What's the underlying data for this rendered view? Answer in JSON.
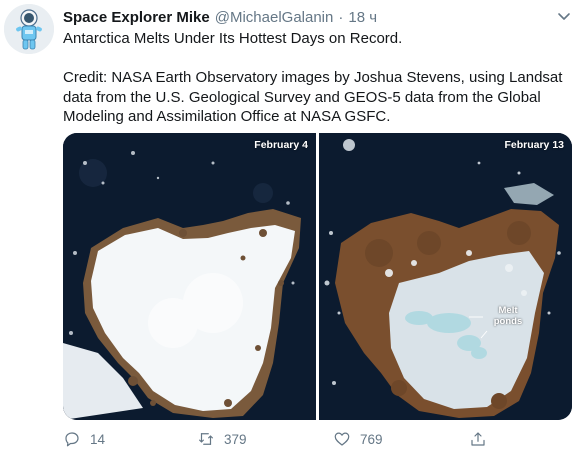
{
  "author": {
    "name": "Space Explorer Mike",
    "handle": "@MichaelGalanin",
    "separator": "·",
    "time": "18 ч",
    "avatar_icon": "astronaut-icon"
  },
  "tweet": {
    "line1": "Antarctica Melts Under Its Hottest Days on Record.",
    "line2": "Credit: NASA Earth Observatory images by Joshua Stevens, using Landsat data from the U.S. Geological Survey and GEOS-5 data from the Global Modeling and Assimilation Office at NASA GSFC."
  },
  "media": {
    "left_date": "February 4",
    "right_date": "February 13",
    "melt_label_line1": "Melt",
    "melt_label_line2": "ponds"
  },
  "actions": {
    "reply_count": "14",
    "retweet_count": "379",
    "like_count": "769"
  },
  "colors": {
    "text_primary": "#14171a",
    "text_secondary": "#657786",
    "ocean": "#0b1a2e"
  }
}
